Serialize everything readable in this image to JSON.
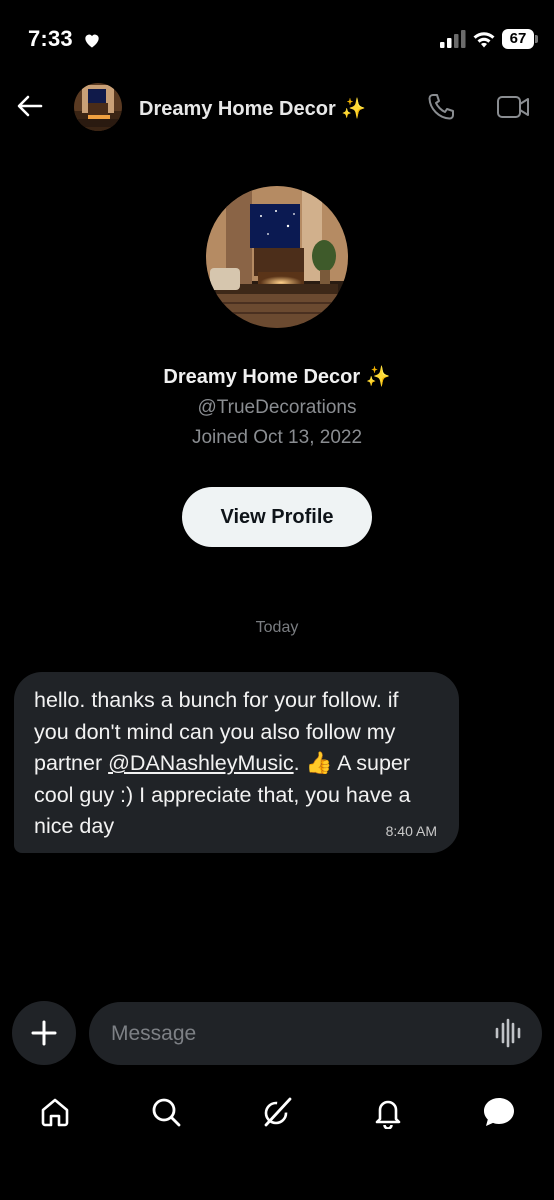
{
  "status_bar": {
    "time": "7:33",
    "battery": "67"
  },
  "header": {
    "title": "Dreamy Home Decor",
    "title_emoji": "✨"
  },
  "profile": {
    "name": "Dreamy Home Decor",
    "name_emoji": "✨",
    "handle": "@TrueDecorations",
    "joined": "Joined Oct 13, 2022",
    "view_profile_label": "View Profile"
  },
  "conversation": {
    "date_divider": "Today",
    "messages": [
      {
        "text_before": "hello. thanks a bunch for your follow. if you don't mind can you also follow my partner ",
        "mention": "@DANashleyMusic",
        "text_after": ". 👍 A super cool guy :) I appreciate that, you have a nice day",
        "time": "8:40 AM"
      }
    ]
  },
  "composer": {
    "placeholder": "Message"
  },
  "bottom_nav": {
    "items": [
      "home-icon",
      "search-icon",
      "grok-icon",
      "notifications-icon",
      "messages-icon"
    ]
  },
  "colors": {
    "background": "#000000",
    "bubble": "#202327",
    "muted_text": "#8a8d91",
    "button_light": "#eff3f4",
    "sparkle": "#f7d24a"
  }
}
